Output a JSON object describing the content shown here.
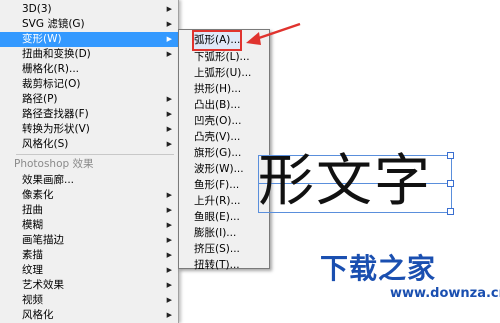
{
  "menu": {
    "items": [
      {
        "label": "3D(3)",
        "submenu": true
      },
      {
        "label": "SVG 滤镜(G)",
        "submenu": true
      },
      {
        "label": "变形(W)",
        "submenu": true,
        "highlighted": true
      },
      {
        "label": "扭曲和变换(D)",
        "submenu": true
      },
      {
        "label": "栅格化(R)...",
        "submenu": false
      },
      {
        "label": "裁剪标记(O)",
        "submenu": false
      },
      {
        "label": "路径(P)",
        "submenu": true
      },
      {
        "label": "路径查找器(F)",
        "submenu": true
      },
      {
        "label": "转换为形状(V)",
        "submenu": true
      },
      {
        "label": "风格化(S)",
        "submenu": true
      }
    ],
    "section_header": "Photoshop 效果",
    "ps_items": [
      {
        "label": "效果画廊...",
        "submenu": false
      },
      {
        "label": "像素化",
        "submenu": true
      },
      {
        "label": "扭曲",
        "submenu": true
      },
      {
        "label": "模糊",
        "submenu": true
      },
      {
        "label": "画笔描边",
        "submenu": true
      },
      {
        "label": "素描",
        "submenu": true
      },
      {
        "label": "纹理",
        "submenu": true
      },
      {
        "label": "艺术效果",
        "submenu": true
      },
      {
        "label": "视频",
        "submenu": true
      },
      {
        "label": "风格化",
        "submenu": true
      }
    ]
  },
  "warp_submenu": {
    "items": [
      {
        "label": "弧形(A)...",
        "selected": true
      },
      {
        "label": "下弧形(L)..."
      },
      {
        "label": "上弧形(U)..."
      },
      {
        "label": "拱形(H)..."
      },
      {
        "label": "凸出(B)..."
      },
      {
        "label": "凹壳(O)..."
      },
      {
        "label": "凸壳(V)..."
      },
      {
        "label": "旗形(G)..."
      },
      {
        "label": "波形(W)..."
      },
      {
        "label": "鱼形(F)..."
      },
      {
        "label": "上升(R)..."
      },
      {
        "label": "鱼眼(E)..."
      },
      {
        "label": "膨胀(I)..."
      },
      {
        "label": "挤压(S)..."
      },
      {
        "label": "扭转(T)..."
      }
    ]
  },
  "artwork": {
    "text": "形文字"
  },
  "watermark": {
    "logo": "下载之家",
    "url": "www.downza.cn"
  },
  "colors": {
    "highlight": "#3399ff",
    "annotation": "#e0332e",
    "watermark": "#1a4fb0"
  }
}
